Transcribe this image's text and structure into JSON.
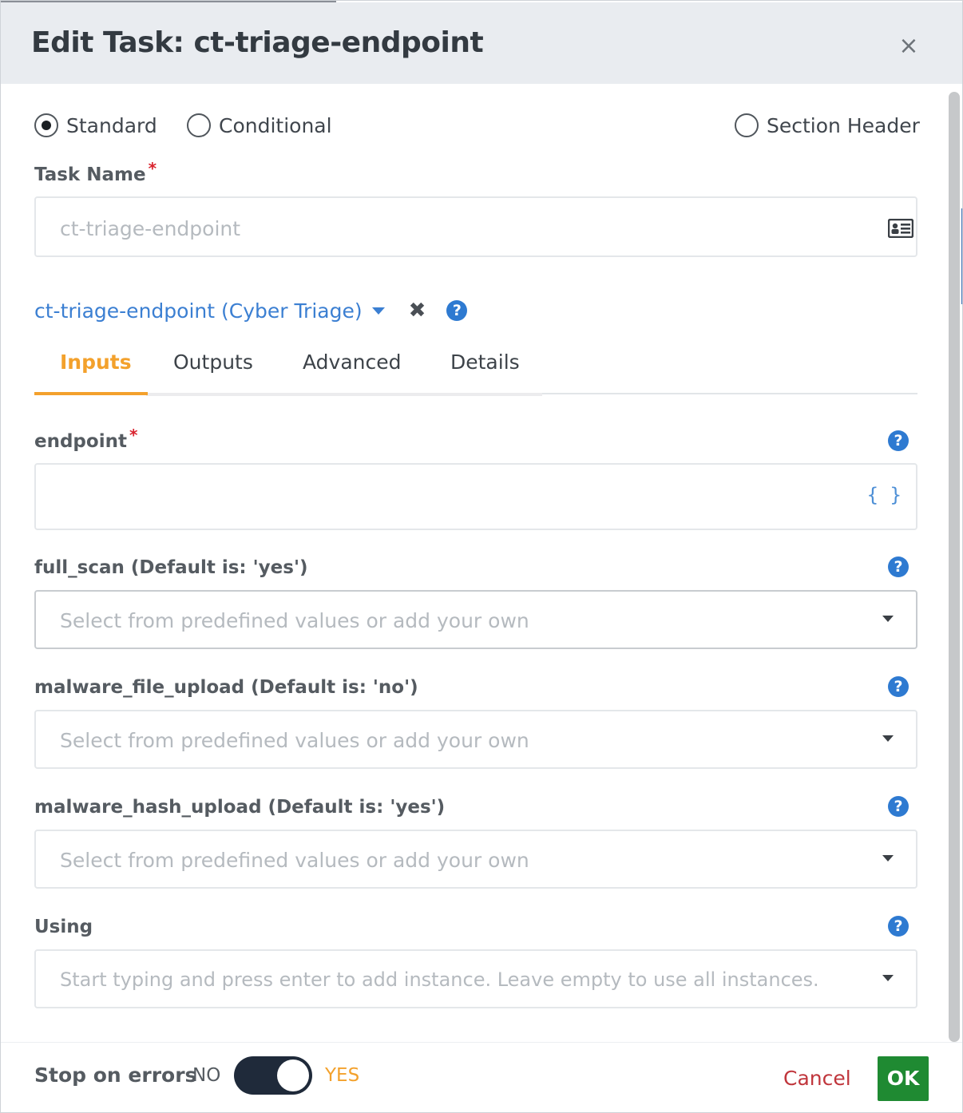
{
  "dialog": {
    "title": "Edit Task: ct-triage-endpoint",
    "close_symbol": "×"
  },
  "task_type": {
    "options": [
      {
        "label": "Standard",
        "checked": true
      },
      {
        "label": "Conditional",
        "checked": false
      },
      {
        "label": "Section Header",
        "checked": false
      }
    ]
  },
  "task_name": {
    "label": "Task Name",
    "required_mark": "*",
    "placeholder": "ct-triage-endpoint",
    "icon": "id-card-icon"
  },
  "integration": {
    "label": "ct-triage-endpoint (Cyber Triage)",
    "clear_symbol": "✖",
    "help_symbol": "?"
  },
  "tabs": [
    {
      "label": "Inputs",
      "active": true
    },
    {
      "label": "Outputs",
      "active": false
    },
    {
      "label": "Advanced",
      "active": false
    },
    {
      "label": "Details",
      "active": false
    }
  ],
  "fields": {
    "endpoint": {
      "label": "endpoint",
      "required_mark": "*",
      "braces": "{ }",
      "help_symbol": "?"
    },
    "full_scan": {
      "label": "full_scan (Default is: 'yes')",
      "placeholder": "Select from predefined values or add your own",
      "help_symbol": "?"
    },
    "malware_file_upload": {
      "label": "malware_file_upload (Default is: 'no')",
      "placeholder": "Select from predefined values or add your own",
      "help_symbol": "?"
    },
    "malware_hash_upload": {
      "label": "malware_hash_upload (Default is: 'yes')",
      "placeholder": "Select from predefined values or add your own",
      "help_symbol": "?"
    },
    "using": {
      "label": "Using",
      "placeholder": "Start typing and press enter to add instance. Leave empty to use all instances.",
      "help_symbol": "?"
    }
  },
  "footer": {
    "stop_on_errors_label": "Stop on errors",
    "no_label": "NO",
    "yes_label": "YES",
    "stop_on_errors_enabled": true,
    "cancel_label": "Cancel",
    "ok_label": "OK"
  },
  "colors": {
    "accent_orange": "#f3a12c",
    "link_blue": "#3b7fd2",
    "ok_green": "#1f8a32",
    "cancel_red": "#c0363c",
    "toggle_dark": "#1f2a3a"
  }
}
